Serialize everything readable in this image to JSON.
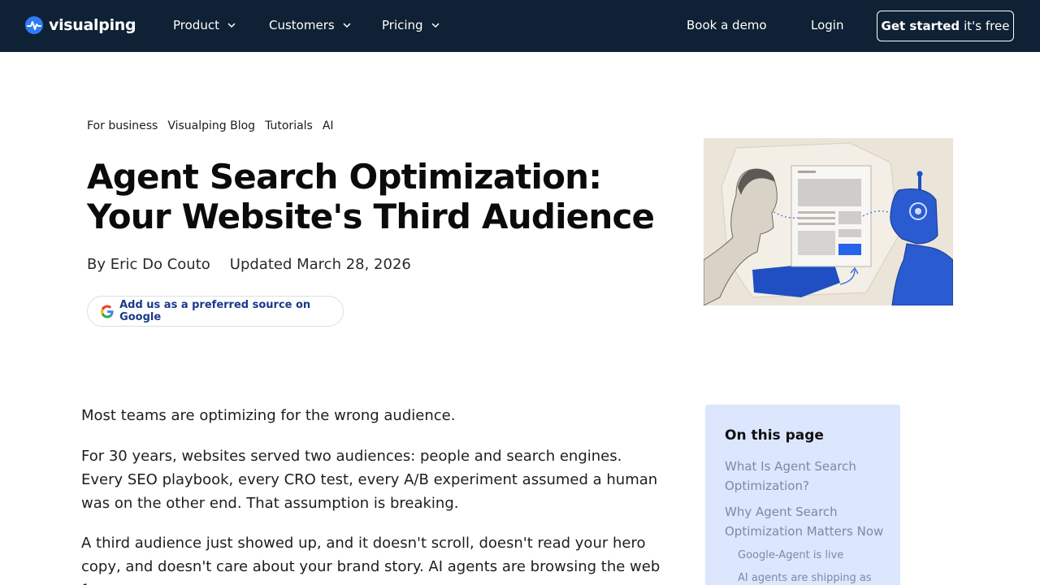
{
  "nav": {
    "logo": "visualping",
    "items": [
      {
        "label": "Product"
      },
      {
        "label": "Customers"
      },
      {
        "label": "Pricing"
      }
    ],
    "book_demo": "Book a demo",
    "login": "Login",
    "cta_strong": "Get started",
    "cta_light": "it's free"
  },
  "breadcrumbs": [
    "For business",
    "Visualping Blog",
    "Tutorials",
    "AI"
  ],
  "article": {
    "title_line1": "Agent Search Optimization:",
    "title_line2": "Your Website's Third Audience",
    "author": "By Eric Do Couto",
    "updated": "Updated March 28, 2026",
    "google_source": "Add us as a preferred source on Google",
    "paragraphs": [
      "Most teams are optimizing for the wrong audience.",
      "For 30 years, websites served two audiences: people and search engines. Every SEO playbook, every CRO test, every A/B experiment assumed a human was on the other end. That assumption is breaking.",
      "A third audience just showed up, and it doesn't scroll, doesn't read your hero copy, and doesn't care about your brand story. AI agents are browsing the web for users"
    ]
  },
  "toc": {
    "title": "On this page",
    "links": [
      "What Is Agent Search Optimization?",
      "Why Agent Search Optimization Matters Now"
    ],
    "sublinks": [
      "Google-Agent is live",
      "AI agents are shipping as"
    ]
  },
  "colors": {
    "nav_bg": "#0f2134",
    "brand_blue": "#2f7cf6",
    "toc_bg": "#dce6fd",
    "link_gray": "#7d8aa3"
  },
  "icons": [
    "pulse-logo-icon",
    "chevron-down-icon",
    "google-g-icon"
  ]
}
